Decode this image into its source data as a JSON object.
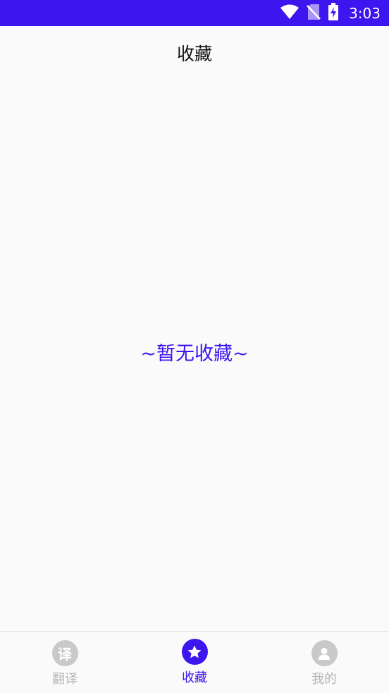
{
  "status_bar": {
    "time": "3:03",
    "icons": [
      "wifi-icon",
      "no-sim-icon",
      "battery-charging-icon"
    ],
    "bg_color": "#3d15ef"
  },
  "app_bar": {
    "title": "收藏"
  },
  "main": {
    "empty_message": "~暂无收藏~"
  },
  "bottom_nav": {
    "items": [
      {
        "label": "翻译",
        "icon": "translate-icon",
        "icon_glyph": "译",
        "active": false
      },
      {
        "label": "收藏",
        "icon": "star-icon",
        "active": true
      },
      {
        "label": "我的",
        "icon": "person-icon",
        "active": false
      }
    ]
  },
  "colors": {
    "accent": "#3d15ef",
    "inactive": "#c9c9cc"
  }
}
